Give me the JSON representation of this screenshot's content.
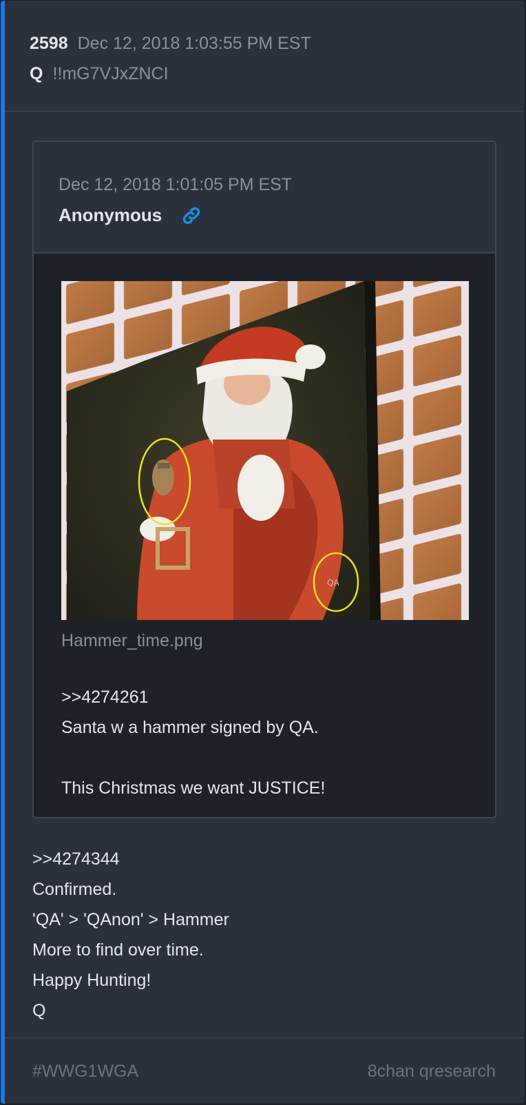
{
  "post": {
    "number": "2598",
    "date": "Dec 12, 2018 1:03:55 PM EST",
    "author": "Q",
    "tripcode": "!!mG7VJxZNCI",
    "accent_color": "#1e78e6"
  },
  "quoted": {
    "date": "Dec 12, 2018 1:01:05 PM EST",
    "author": "Anonymous",
    "link_icon": "link-icon",
    "image_filename": "Hammer_time.png",
    "lines": [
      ">>4274261",
      "Santa w a hammer signed by QA.",
      "",
      "This Christmas we want JUSTICE!"
    ]
  },
  "body": {
    "lines": [
      ">>4274344",
      "Confirmed.",
      "'QA' > 'QAnon' > Hammer",
      "More to find over time.",
      "Happy Hunting!",
      "Q"
    ]
  },
  "footer": {
    "hashtag": "#WWG1WGA",
    "source": "8chan qresearch"
  }
}
